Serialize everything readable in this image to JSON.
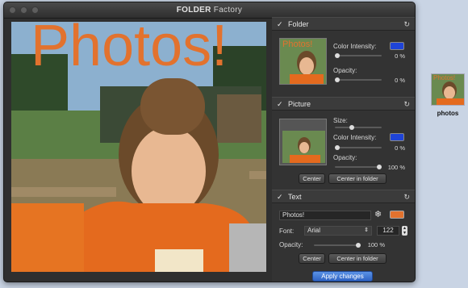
{
  "window": {
    "title_bold": "FOLDER",
    "title_rest": "Factory"
  },
  "preview": {
    "overlay_text": "Photos!"
  },
  "folder_section": {
    "title": "Folder",
    "color_intensity_label": "Color Intensity:",
    "color_intensity_value": "0 %",
    "color": "#1f44d8",
    "opacity_label": "Opacity:",
    "opacity_value": "0 %",
    "thumb_text": "Photos!"
  },
  "picture_section": {
    "title": "Picture",
    "size_label": "Size:",
    "size_level": 0.32,
    "color_intensity_label": "Color Intensity:",
    "color_intensity_value": "0 %",
    "color": "#1f44d8",
    "opacity_label": "Opacity:",
    "opacity_value": "100 %",
    "center_button": "Center",
    "center_in_folder_button": "Center in folder"
  },
  "text_section": {
    "title": "Text",
    "text_value": "Photos!",
    "color": "#e2722e",
    "font_label": "Font:",
    "font_value": "Arial",
    "font_size": "122",
    "opacity_label": "Opacity:",
    "opacity_value": "100 %",
    "center_button": "Center",
    "center_in_folder_button": "Center in folder"
  },
  "apply_button": "Apply changes",
  "desktop_icon": {
    "label": "photos",
    "overlay_text": "Photos!"
  },
  "colors": {
    "accent": "#2f64c4",
    "text_orange": "#e2722e",
    "swatch_blue": "#1f44d8"
  }
}
